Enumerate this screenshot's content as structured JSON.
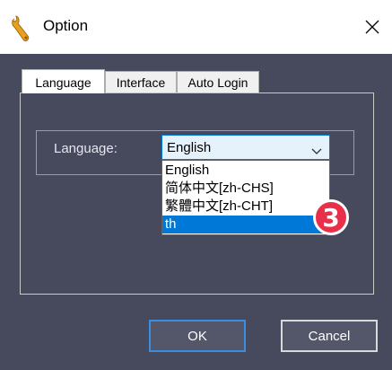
{
  "window": {
    "title": "Option",
    "close_glyph": "✕"
  },
  "tabs": [
    {
      "label": "Language",
      "active": true
    },
    {
      "label": "Interface",
      "active": false
    },
    {
      "label": "Auto Login",
      "active": false
    }
  ],
  "language": {
    "label": "Language:",
    "selected_value": "English",
    "options": [
      "English",
      "简体中文[zh-CHS]",
      "繁體中文[zh-CHT]",
      "th"
    ],
    "highlighted_option": "th"
  },
  "annotation": {
    "badge_number": "3",
    "badge_color": "#e8304a"
  },
  "buttons": {
    "ok_label": "OK",
    "cancel_label": "Cancel"
  },
  "colors": {
    "window_bg": "#474a5c",
    "accent": "#0078d7"
  },
  "icons": {
    "app": "wrench-icon",
    "close": "close-icon",
    "dropdown": "chevron-down-icon"
  }
}
